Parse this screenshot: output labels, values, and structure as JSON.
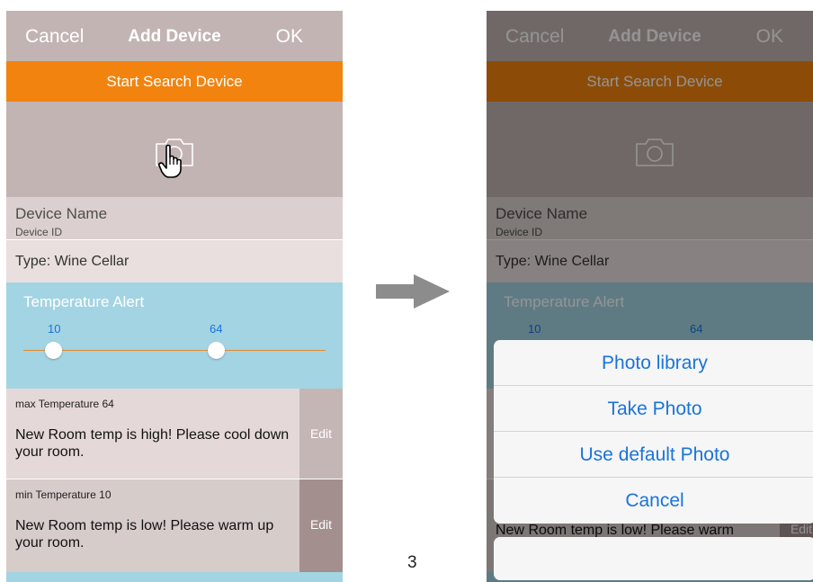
{
  "screens": [
    {
      "nav": {
        "cancel": "Cancel",
        "title": "Add Device",
        "ok": "OK"
      },
      "search_label": "Start Search Device",
      "device_name": "Device Name",
      "device_id": "Device ID",
      "type": "Type: Wine Cellar",
      "temperature": {
        "title": "Temperature Alert",
        "slider_min_label": "10",
        "slider_max_label": "64",
        "slider_min_value": 10,
        "slider_max_value": 64
      },
      "max_alert": {
        "header": "max Temperature 64",
        "message": "New Room temp is high! Please cool down your room.",
        "edit": "Edit"
      },
      "min_alert": {
        "header": "min Temperature 10",
        "message": "New Room temp is low! Please warm up your room.",
        "edit": "Edit"
      }
    },
    {
      "nav": {
        "cancel": "Cancel",
        "title": "Add Device",
        "ok": "OK"
      },
      "search_label": "Start Search Device",
      "device_name": "Device Name",
      "device_id": "Device ID",
      "type": "Type: Wine Cellar",
      "temperature": {
        "title": "Temperature Alert",
        "slider_min_label": "10",
        "slider_max_label": "64"
      },
      "min_alert": {
        "message": "New Room temp is low! Please warm",
        "edit": "Edit"
      },
      "action_sheet": {
        "options": [
          "Photo library",
          "Take Photo",
          "Use default Photo",
          "Cancel"
        ]
      }
    }
  ],
  "page_number": "3",
  "colors": {
    "nav_bar": "#c2b4b2",
    "search_button": "#f2830e",
    "temperature_panel": "#a3d4e3",
    "slider_track": "#e08a2e",
    "action_sheet_text": "#1a74d9"
  },
  "icons": [
    "camera-icon",
    "pointing-hand-icon",
    "right-arrow-icon"
  ]
}
